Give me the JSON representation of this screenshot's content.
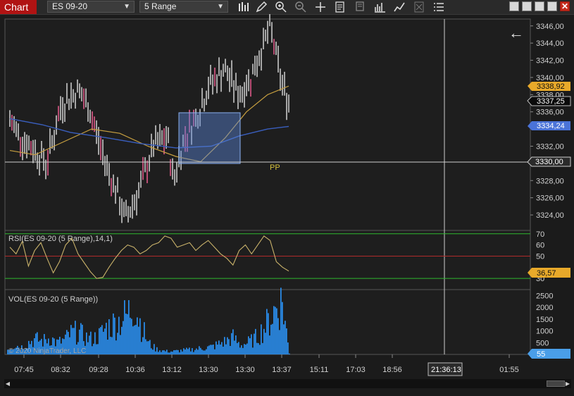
{
  "toolbar": {
    "tab_label": "Chart",
    "instrument": "ES 09-20",
    "bar_type": "5 Range",
    "icons": [
      "bar-style-icon",
      "drawing-pencil-icon",
      "zoom-in-icon",
      "zoom-out-icon",
      "crosshair-icon",
      "data-box-icon",
      "properties-icon",
      "indicators-icon",
      "strategies-icon",
      "templates-icon",
      "menu-list-icon"
    ]
  },
  "window_controls": {
    "close_label": "✕"
  },
  "price_panel": {
    "price_labels": [
      {
        "text": "3346,00",
        "value": 3346
      },
      {
        "text": "3344,00",
        "value": 3344
      },
      {
        "text": "3342,00",
        "value": 3342
      },
      {
        "text": "3340,00",
        "value": 3340
      },
      {
        "text": "3338,00",
        "value": 3338
      },
      {
        "text": "3336,00",
        "value": 3336
      },
      {
        "text": "3332,00",
        "value": 3332
      },
      {
        "text": "3328,00",
        "value": 3328
      },
      {
        "text": "3326,00",
        "value": 3326
      },
      {
        "text": "3324,00",
        "value": 3324
      }
    ],
    "last_price": {
      "text": "3337,25",
      "value": 3337.25
    },
    "sma_price": {
      "text": "3338,92",
      "value": 3338.92
    },
    "blue_ma_price": {
      "text": "3334,24",
      "value": 3334.24
    },
    "cursor_price": {
      "text": "3330,00",
      "value": 3330
    },
    "pp_label": "PP",
    "range": [
      3322.2,
      3346.8
    ],
    "back_arrow": "←",
    "colors": {
      "bar": "#c8c8c8",
      "bar_highlight": "#e05a8a",
      "gold_ma": "#c8a040",
      "blue_ma": "#3a5fbf",
      "box": "#6b93d6"
    }
  },
  "rsi_panel": {
    "title": "RSI(ES 09-20 (5 Range),14,1)",
    "levels": [
      {
        "text": "70",
        "value": 70
      },
      {
        "text": "60",
        "value": 60
      },
      {
        "text": "50",
        "value": 50
      },
      {
        "text": "30",
        "value": 30
      }
    ],
    "current": {
      "text": "36,57",
      "value": 36.57
    },
    "range": [
      20,
      73
    ]
  },
  "vol_panel": {
    "title": "VOL(ES 09-20 (5 Range))",
    "levels": [
      {
        "text": "2500",
        "value": 2500
      },
      {
        "text": "2000",
        "value": 2000
      },
      {
        "text": "1500",
        "value": 1500
      },
      {
        "text": "1000",
        "value": 1000
      },
      {
        "text": "500",
        "value": 500
      }
    ],
    "current": {
      "text": "55",
      "value": 55
    },
    "copyright": "© 2020 NinjaTrader, LLC",
    "range": [
      0,
      2750
    ]
  },
  "time_axis": {
    "labels": [
      "07:45",
      "08:32",
      "09:28",
      "10:36",
      "13:12",
      "13:30",
      "13:30",
      "13:37",
      "15:11",
      "17:03",
      "18:56",
      "01:55"
    ],
    "cursor_time": "21:36:13"
  },
  "chart_data": {
    "type": "line",
    "series": [
      {
        "name": "RSI(ES 09-20 (5 Range),14,1)",
        "values": [
          58,
          52,
          63,
          41,
          55,
          62,
          48,
          35,
          45,
          60,
          66,
          52,
          44,
          36,
          30,
          31,
          40,
          48,
          55,
          60,
          58,
          52,
          55,
          60,
          62,
          68,
          66,
          58,
          60,
          62,
          55,
          60,
          64,
          58,
          52,
          48,
          42,
          55,
          60,
          52,
          60,
          68,
          64,
          45,
          40,
          36.57
        ]
      },
      {
        "name": "VOL(ES 09-20 (5 Range))",
        "values": [
          300,
          500,
          400,
          650,
          800,
          700,
          900,
          600,
          750,
          1100,
          1200,
          900,
          800,
          1000,
          1400,
          1600,
          1800,
          2100,
          2700,
          1500,
          600,
          300,
          200,
          150,
          180,
          220,
          250,
          300,
          350,
          400,
          550,
          700,
          900,
          500,
          600,
          800,
          1200,
          1700,
          2400,
          2800,
          55
        ]
      }
    ],
    "price_range": [
      3322.2,
      3346.8
    ],
    "rsi_ylim": [
      20,
      73
    ],
    "vol_ylim": [
      0,
      2750
    ]
  }
}
